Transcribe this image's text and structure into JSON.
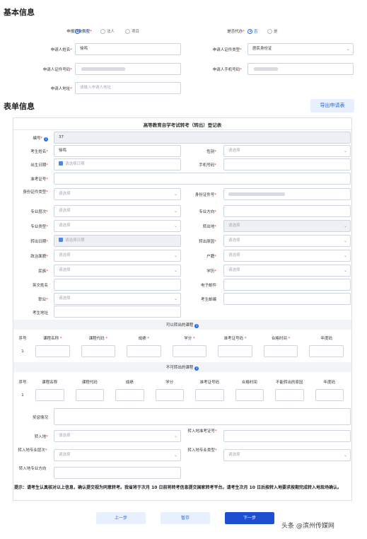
{
  "basic": {
    "title": "基本信息",
    "applicant_type_label": "申报对象类型",
    "applicant_type_options": [
      "个人",
      "法人",
      "项目"
    ],
    "proxy_label": "是否代办",
    "proxy_options": [
      "否",
      "是"
    ],
    "name_label": "申请人姓名",
    "name_value": "徐鸣",
    "id_type_label": "申请人证件类型",
    "id_type_value": "居民身份证",
    "id_no_label": "申请人证件号码",
    "phone_label": "申请人手机号码",
    "address_label": "申请人地址",
    "address_placeholder": "请输入申请人地址"
  },
  "form": {
    "section_title": "表单信息",
    "export_button": "导出申请表",
    "table_title": "高等教育自学考试转考（转出）登记表",
    "serial_label": "编号",
    "serial_value": "37",
    "exam_name_label": "考生姓名",
    "exam_name_value": "徐鸣",
    "gender_label": "性别",
    "select_placeholder": "请选择",
    "date_placeholder": "请选择日期",
    "birth_label": "出生日期",
    "phone_label": "手机号码",
    "admission_label": "准考证号",
    "idtype_label": "身份证件类型",
    "idno_label": "身份证件号",
    "level_label": "专业层次",
    "direction_label": "专业方向",
    "major_type_label": "专业类型",
    "transfer_out_label": "转出地",
    "transfer_date_label": "转出日期",
    "reason_label": "转出原因",
    "politics_label": "政治面貌",
    "hukou_label": "户籍",
    "ethnic_label": "民族",
    "education_label": "学历",
    "en_name_label": "英文姓名",
    "email_label": "电子邮件",
    "job_label": "职业",
    "postcode_label": "考生邮编",
    "home_addr_label": "考生地址",
    "transferable_title": "可以转出的课程",
    "t_headers": [
      "序号",
      "课程名称",
      "课程代码",
      "成绩",
      "学分",
      "准考证号码",
      "合格时间",
      "年度码"
    ],
    "t_required": [
      false,
      true,
      true,
      true,
      true,
      true,
      true,
      false
    ],
    "t_row_no": "1",
    "nontransferable_title": "不可转出的课程",
    "n_headers": [
      "序号",
      "课程名称",
      "课程代码",
      "成绩",
      "学分",
      "准考证号码",
      "合格时间",
      "不能转出的原因",
      "年度码"
    ],
    "n_row_no": "1",
    "award_label": "奖惩情况",
    "in_place_label": "转入地",
    "in_cert_label": "转入地准考证号",
    "in_level_label": "转入地专业层次",
    "in_type_label": "转入地专业类型",
    "in_direction_label": "转入地专业方向",
    "tip": "提示：请考生认真核对以上信息，确认提交视为同意转考。我省将于次月 10 日前将转考信息提交国家转考平台。请考生次月 10 日后按转入地要求按期完成转入地现场确认。"
  },
  "footer": {
    "prev": "上一步",
    "save": "暂存",
    "next": "下一步",
    "watermark": "头条 @滨州传媒网"
  },
  "colors": {
    "accent": "#2468f2",
    "required": "#e33"
  }
}
